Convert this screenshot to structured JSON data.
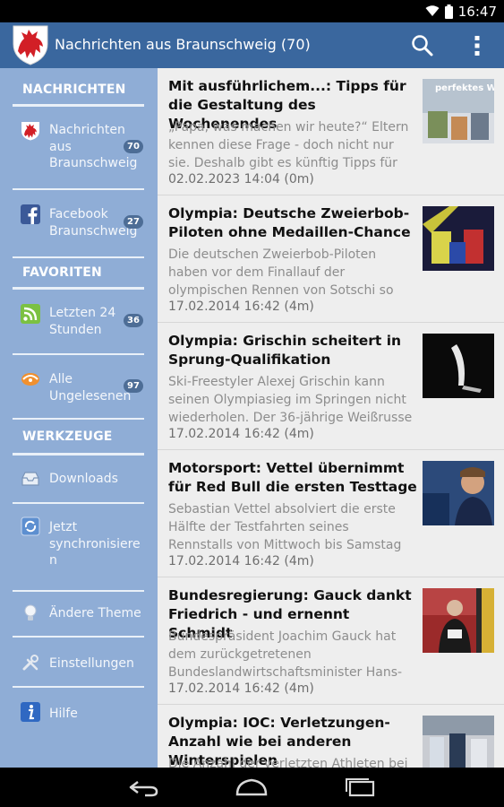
{
  "status": {
    "time": "16:47",
    "icons": [
      "wifi-icon",
      "battery-icon"
    ]
  },
  "app_bar": {
    "title": "Nachrichten aus Braunschweig (70)",
    "logo": "braunschweig-lion-crest",
    "actions": [
      "search-icon",
      "overflow-menu-icon"
    ],
    "color": "#3a679e"
  },
  "sidebar": {
    "background": "#8fadd6",
    "sections": [
      {
        "header": "NACHRICHTEN",
        "items": [
          {
            "label": "Nachrichten aus Braunschweig",
            "badge": "70",
            "icon": "lion-crest-icon"
          },
          {
            "label": "Facebook Braunschweig",
            "badge": "27",
            "icon": "facebook-icon"
          }
        ]
      },
      {
        "header": "FAVORITEN",
        "items": [
          {
            "label": "Letzten 24 Stunden",
            "badge": "36",
            "icon": "rss-icon"
          },
          {
            "label": "Alle Ungelesenen",
            "badge": "97",
            "icon": "unread-icon"
          }
        ]
      },
      {
        "header": "WERKZEUGE",
        "items": [
          {
            "label": "Downloads",
            "icon": "inbox-icon"
          },
          {
            "label": "Jetzt synchronisieren",
            "icon": "sync-icon"
          },
          {
            "label": "Ändere Theme",
            "icon": "lightbulb-icon"
          },
          {
            "label": "Einstellungen",
            "icon": "tools-icon"
          },
          {
            "label": "Hilfe",
            "icon": "info-icon"
          }
        ]
      }
    ]
  },
  "articles": [
    {
      "title": "Mit ausführlichem...: Tipps für die Gestaltung des Wochenendes",
      "excerpt": [
        "„Papa, was machen wir heute?“ Eltern",
        "kennen diese Frage - doch nicht nur",
        "sie. Deshalb gibt es künftig Tipps für"
      ],
      "date": "02.02.2023 14:04 (0m)",
      "thumb_text": "perfektes Wochenende"
    },
    {
      "title": "Olympia: Deutsche Zweierbob-Piloten ohne Medaillen-Chance",
      "excerpt": [
        "Die deutschen Zweierbob-Piloten",
        "haben vor dem Finallauf der",
        "olympischen Rennen von Sotschi so"
      ],
      "date": "17.02.2014 16:42 (4m)"
    },
    {
      "title": "Olympia: Grischin scheitert in Sprung-Qualifikation",
      "excerpt": [
        "Ski-Freestyler Alexej Grischin kann",
        "seinen Olympiasieg im Springen nicht",
        "wiederholen. Der 36-jährige Weißrusse"
      ],
      "date": "17.02.2014 16:42 (4m)"
    },
    {
      "title": "Motorsport: Vettel übernimmt für Red Bull die ersten Testtage",
      "excerpt": [
        "Sebastian Vettel absolviert die erste",
        "Hälfte der Testfahrten seines",
        "Rennstalls von Mittwoch bis Samstag"
      ],
      "date": "17.02.2014 16:42 (4m)"
    },
    {
      "title": "Bundesregierung: Gauck dankt Friedrich - und ernennt Schmidt",
      "excerpt": [
        "Bundespräsident Joachim Gauck hat",
        "dem zurückgetretenen",
        "Bundeslandwirtschaftsminister Hans-"
      ],
      "date": "17.02.2014 16:42 (4m)"
    },
    {
      "title": "Olympia: IOC: Verletzungen-Anzahl wie bei anderen Winterspielen",
      "excerpt": [
        "Die Anzahl der verletzten Athleten bei"
      ],
      "date": ""
    }
  ],
  "nav_bar": {
    "buttons": [
      "back-icon",
      "home-icon",
      "recent-apps-icon"
    ]
  }
}
